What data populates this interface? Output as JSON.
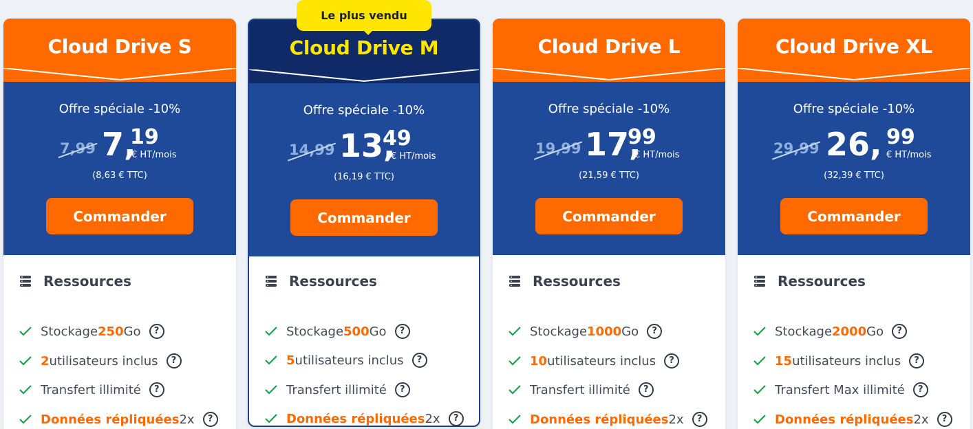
{
  "badge": {
    "label": "Le plus vendu"
  },
  "plans": [
    {
      "name": "Cloud Drive S",
      "offer": "Offre spéciale -10%",
      "old_price": "7,99",
      "price_int": "7,",
      "price_dec": "19",
      "price_unit": "€ HT/mois",
      "ttc": "(8,63 € TTC)",
      "button": "Commander",
      "resources_title": "Ressources",
      "features": {
        "storage_prefix": "Stockage ",
        "storage_value": "250",
        "storage_suffix": " Go",
        "users_value": "2",
        "users_suffix": " utilisateurs inclus",
        "transfer": "Transfert illimité",
        "replication_label": "Données répliquées",
        "replication_value": " 2x"
      }
    },
    {
      "name": "Cloud Drive M",
      "offer": "Offre spéciale -10%",
      "old_price": "14,99",
      "price_int": "13,",
      "price_dec": "49",
      "price_unit": "€ HT/mois",
      "ttc": "(16,19 € TTC)",
      "button": "Commander",
      "resources_title": "Ressources",
      "features": {
        "storage_prefix": "Stockage ",
        "storage_value": "500",
        "storage_suffix": " Go",
        "users_value": "5",
        "users_suffix": " utilisateurs inclus",
        "transfer": "Transfert illimité",
        "replication_label": "Données répliquées",
        "replication_value": " 2x"
      }
    },
    {
      "name": "Cloud Drive L",
      "offer": "Offre spéciale -10%",
      "old_price": "19,99",
      "price_int": "17,",
      "price_dec": "99",
      "price_unit": "€ HT/mois",
      "ttc": "(21,59 € TTC)",
      "button": "Commander",
      "resources_title": "Ressources",
      "features": {
        "storage_prefix": "Stockage ",
        "storage_value": "1000",
        "storage_suffix": " Go",
        "users_value": "10",
        "users_suffix": " utilisateurs inclus",
        "transfer": "Transfert illimité",
        "replication_label": "Données répliquées",
        "replication_value": " 2x"
      }
    },
    {
      "name": "Cloud Drive XL",
      "offer": "Offre spéciale -10%",
      "old_price": "29,99",
      "price_int": "26,",
      "price_dec": "99",
      "price_unit": "€ HT/mois",
      "ttc": "(32,39 € TTC)",
      "button": "Commander",
      "resources_title": "Ressources",
      "features": {
        "storage_prefix": "Stockage ",
        "storage_value": "2000",
        "storage_suffix": " Go",
        "users_value": "15",
        "users_suffix": " utilisateurs inclus",
        "transfer": "Transfert Max illimité",
        "replication_label": "Données répliquées",
        "replication_value": " 2x"
      }
    }
  ],
  "help_glyph": "?",
  "colors": {
    "orange": "#ff6a00",
    "blue": "#1f4a9a",
    "navy": "#0f2a66",
    "yellow": "#ffe600",
    "check": "#1aa34a"
  },
  "icons": {
    "resources": "server-stack-icon",
    "feature": "check-icon",
    "help": "question-circle-icon"
  }
}
